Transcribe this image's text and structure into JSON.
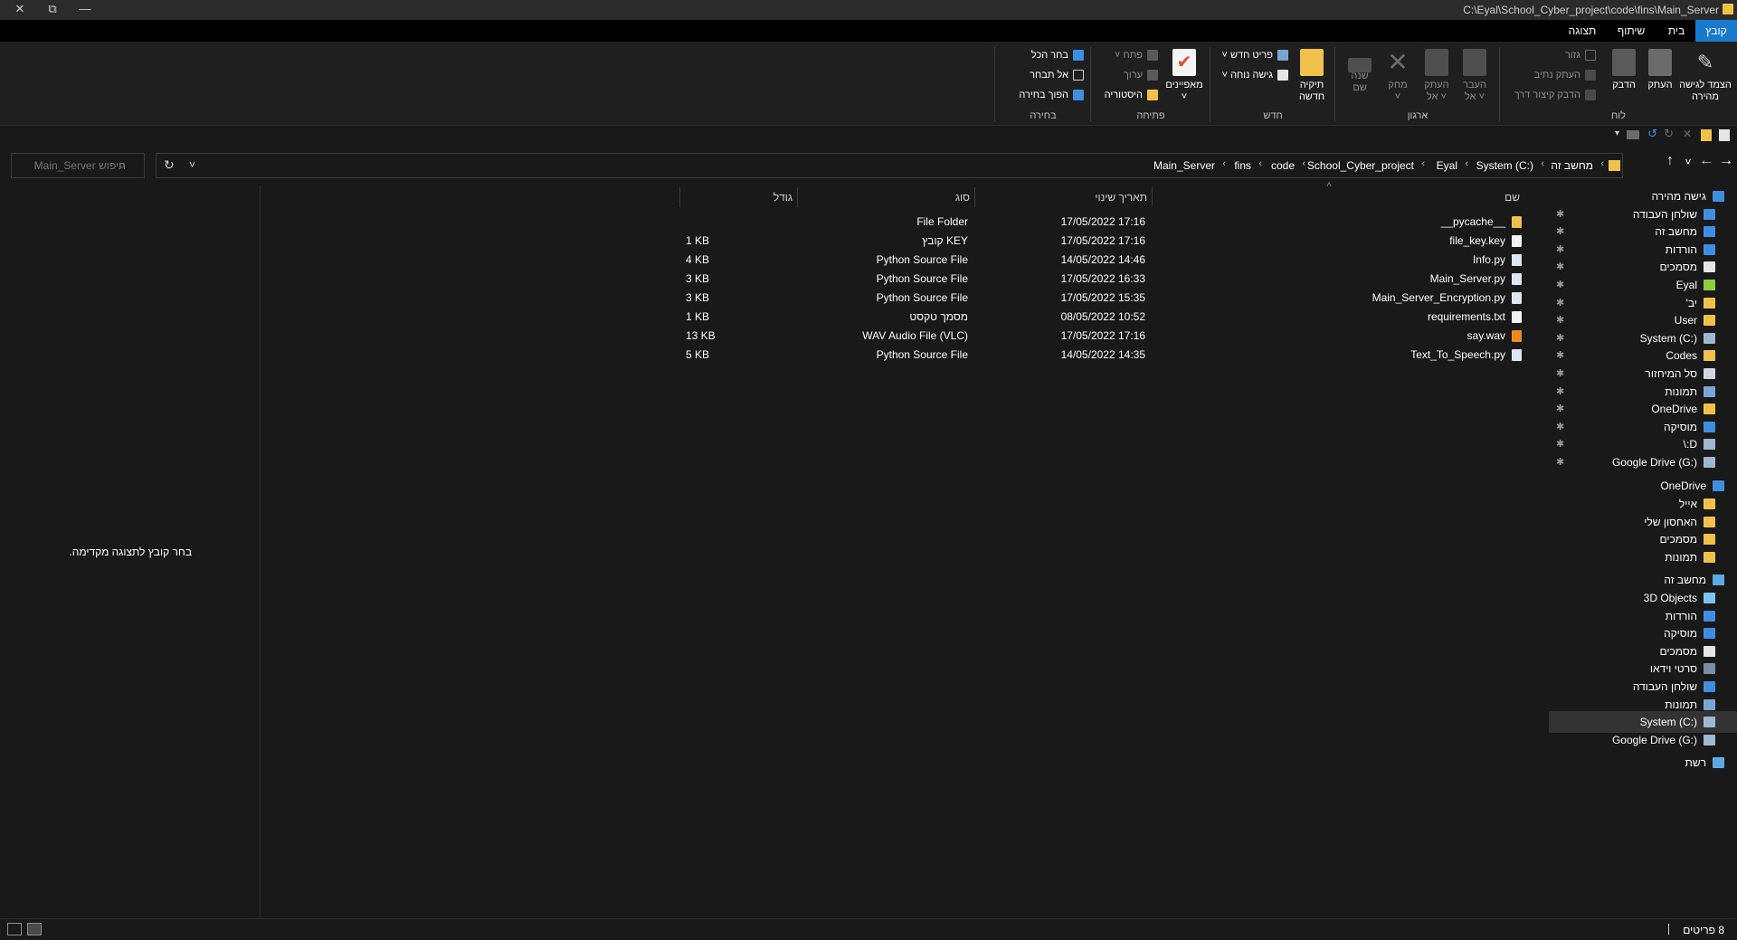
{
  "window": {
    "title_path": "C:\\Eyal\\School_Cyber_project\\code\\fins\\Main_Server",
    "close_glyph": "✕",
    "restore_glyph": "⧉",
    "minimize_glyph": "—"
  },
  "ribbon_tabs": {
    "file": "קובץ",
    "home": "בית",
    "share": "שיתוף",
    "view": "תצוגה",
    "help_glyph": "?",
    "collapse_glyph": "⌃"
  },
  "ribbon": {
    "clipboard": {
      "pin": "הצמד לגישה\nמהירה",
      "copy": "העתק",
      "paste": "הדבק",
      "cut": "גזור",
      "copy_path": "העתק נתיב",
      "paste_shortcut": "הדבק קיצור דרך",
      "group": "לוח"
    },
    "organize": {
      "move_to": "העבר\nאל ˅",
      "copy_to": "העתק\nאל ˅",
      "delete": "מחק\n˅",
      "rename": "שנה\nשם",
      "group": "ארגון"
    },
    "new": {
      "new_folder": "תיקיה\nחדשה",
      "new_item": "פריט חדש ˅",
      "easy_access": "גישה נוחה ˅",
      "group": "חדש"
    },
    "open": {
      "properties": "מאפיינים\n˅",
      "open": "פתח ˅",
      "edit": "ערוך",
      "history": "היסטוריה",
      "group": "פתיחה"
    },
    "select": {
      "select_all": "בחר הכל",
      "select_none": "אל תבחר",
      "invert": "הפוך בחירה",
      "group": "בחירה"
    }
  },
  "address": {
    "crumbs": [
      "מחשב זה",
      "System (C:)",
      "Eyal",
      "School_Cyber_project",
      "code",
      "fins",
      "Main_Server"
    ],
    "sep": "‹",
    "back_glyph": "←",
    "forward_glyph": "→",
    "recent_glyph": "˅",
    "up_glyph": "↑",
    "refresh_glyph": "↻",
    "dropdown_glyph": "˅"
  },
  "search": {
    "placeholder": "חיפוש Main_Server",
    "icon": "⌕"
  },
  "columns": {
    "name": "שם",
    "date": "תאריך שינוי",
    "type": "סוג",
    "size": "גודל",
    "sort_glyph": "˄"
  },
  "files": [
    {
      "name": "__pycache__",
      "date": "17/05/2022 17:16",
      "type": "File Folder",
      "size": "",
      "icon": "folder-icon"
    },
    {
      "name": "file_key.key",
      "date": "17/05/2022 17:16",
      "type": "קובץ KEY",
      "size": "1 KB",
      "icon": "file-icon"
    },
    {
      "name": "Info.py",
      "date": "14/05/2022 14:46",
      "type": "Python Source File",
      "size": "4 KB",
      "icon": "python-file-icon"
    },
    {
      "name": "Main_Server.py",
      "date": "17/05/2022 16:33",
      "type": "Python Source File",
      "size": "3 KB",
      "icon": "python-file-icon"
    },
    {
      "name": "Main_Server_Encryption.py",
      "date": "17/05/2022 15:35",
      "type": "Python Source File",
      "size": "3 KB",
      "icon": "python-file-icon"
    },
    {
      "name": "requirements.txt",
      "date": "08/05/2022 10:52",
      "type": "מסמך טקסט",
      "size": "1 KB",
      "icon": "text-file-icon"
    },
    {
      "name": "say.wav",
      "date": "17/05/2022 17:16",
      "type": "WAV Audio File (VLC)",
      "size": "13 KB",
      "icon": "vlc-icon"
    },
    {
      "name": "Text_To_Speech.py",
      "date": "14/05/2022 14:35",
      "type": "Python Source File",
      "size": "5 KB",
      "icon": "python-file-icon"
    }
  ],
  "nav": {
    "pin_glyph": "✱",
    "quick_access": "גישה מהירה",
    "quick_items": [
      "שולחן העבודה",
      "מחשב זה",
      "הורדות",
      "מסמכים",
      "Eyal",
      "יב'",
      "User",
      "System (C:)",
      "Codes",
      "סל המיחזור",
      "תמונות",
      "OneDrive",
      "מוסיקה",
      "D:\\",
      "Google Drive (G:)"
    ],
    "onedrive": "OneDrive",
    "onedrive_items": [
      "אייל",
      "האחסון שלי",
      "מסמכים",
      "תמונות"
    ],
    "this_pc": "מחשב זה",
    "pc_items": [
      "3D Objects",
      "הורדות",
      "מוסיקה",
      "מסמכים",
      "סרטי וידאו",
      "שולחן העבודה",
      "תמונות",
      "System (C:)",
      "Google Drive (G:)"
    ],
    "network": "רשת"
  },
  "preview": {
    "message": "בחר קובץ לתצוגה מקדימה."
  },
  "status": {
    "items": "8 פריטים"
  },
  "colors": {
    "accent": "#1979ca",
    "folder": "#f0c24b",
    "background": "#191919"
  }
}
